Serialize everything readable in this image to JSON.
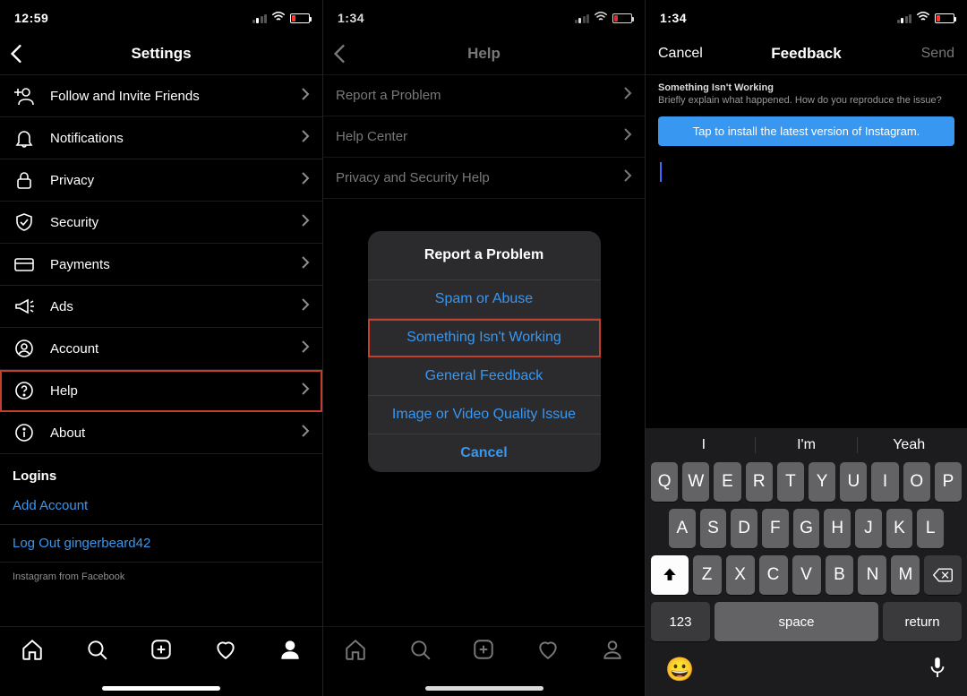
{
  "panel1": {
    "status_time": "12:59",
    "header_title": "Settings",
    "items": [
      {
        "label": "Follow and Invite Friends",
        "icon": "person-plus-icon"
      },
      {
        "label": "Notifications",
        "icon": "bell-icon"
      },
      {
        "label": "Privacy",
        "icon": "lock-icon"
      },
      {
        "label": "Security",
        "icon": "shield-icon"
      },
      {
        "label": "Payments",
        "icon": "card-icon"
      },
      {
        "label": "Ads",
        "icon": "megaphone-icon"
      },
      {
        "label": "Account",
        "icon": "account-icon"
      },
      {
        "label": "Help",
        "icon": "help-icon"
      },
      {
        "label": "About",
        "icon": "info-icon"
      }
    ],
    "logins_section": "Logins",
    "add_account": "Add Account",
    "logout": "Log Out gingerbeard42",
    "footer": "Instagram from Facebook"
  },
  "panel2": {
    "status_time": "1:34",
    "header_title": "Help",
    "items": [
      {
        "label": "Report a Problem"
      },
      {
        "label": "Help Center"
      },
      {
        "label": "Privacy and Security Help"
      }
    ],
    "sheet_title": "Report a Problem",
    "sheet_options": [
      "Spam or Abuse",
      "Something Isn't Working",
      "General Feedback",
      "Image or Video Quality Issue"
    ],
    "sheet_cancel": "Cancel"
  },
  "panel3": {
    "status_time": "1:34",
    "header_title": "Feedback",
    "header_left": "Cancel",
    "header_right": "Send",
    "fb_title": "Something Isn't Working",
    "fb_sub": "Briefly explain what happened. How do you reproduce the issue?",
    "banner": "Tap to install the latest version of Instagram.",
    "suggest": [
      "I",
      "I'm",
      "Yeah"
    ],
    "rows": {
      "r1": [
        "Q",
        "W",
        "E",
        "R",
        "T",
        "Y",
        "U",
        "I",
        "O",
        "P"
      ],
      "r2": [
        "A",
        "S",
        "D",
        "F",
        "G",
        "H",
        "J",
        "K",
        "L"
      ],
      "r3": [
        "Z",
        "X",
        "C",
        "V",
        "B",
        "N",
        "M"
      ]
    },
    "key_num": "123",
    "key_space": "space",
    "key_return": "return"
  }
}
